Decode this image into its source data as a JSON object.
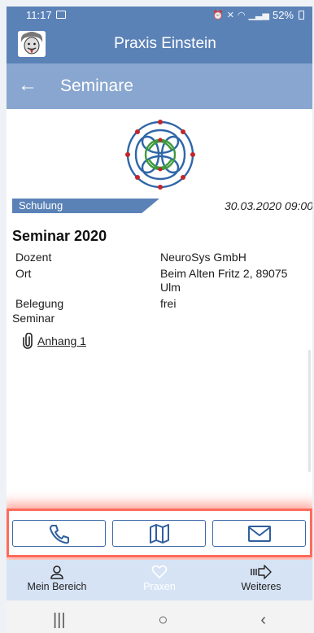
{
  "status_bar": {
    "time": "11:17",
    "battery": "52%"
  },
  "app_bar": {
    "title": "Praxis Einstein"
  },
  "sub_bar": {
    "back_symbol": "←",
    "title": "Seminare"
  },
  "event": {
    "category": "Schulung",
    "datetime": "30.03.2020 09:00",
    "title": "Seminar 2020",
    "details": [
      {
        "label": "Dozent",
        "value": "NeuroSys GmbH"
      },
      {
        "label": "Ort",
        "value": "Beim Alten Fritz 2, 89075 Ulm"
      },
      {
        "label": "Belegung",
        "value": "frei"
      }
    ],
    "section_label": "Seminar",
    "attachment": "Anhang 1"
  },
  "actions": [
    {
      "icon": "phone-icon"
    },
    {
      "icon": "map-icon"
    },
    {
      "icon": "mail-icon"
    }
  ],
  "bottom_nav": [
    {
      "label": "Mein Bereich",
      "icon": "person-icon"
    },
    {
      "label": "Praxen",
      "icon": "heart-icon"
    },
    {
      "label": "Weiteres",
      "icon": "more-arrow-icon"
    }
  ],
  "system_nav": {
    "recents": "|||",
    "home": "○",
    "back": "‹"
  },
  "colors": {
    "primary": "#5b82b7",
    "secondary": "#88a6cf",
    "nav_bg": "#d6e3f5",
    "highlight": "#ff6b5c"
  }
}
